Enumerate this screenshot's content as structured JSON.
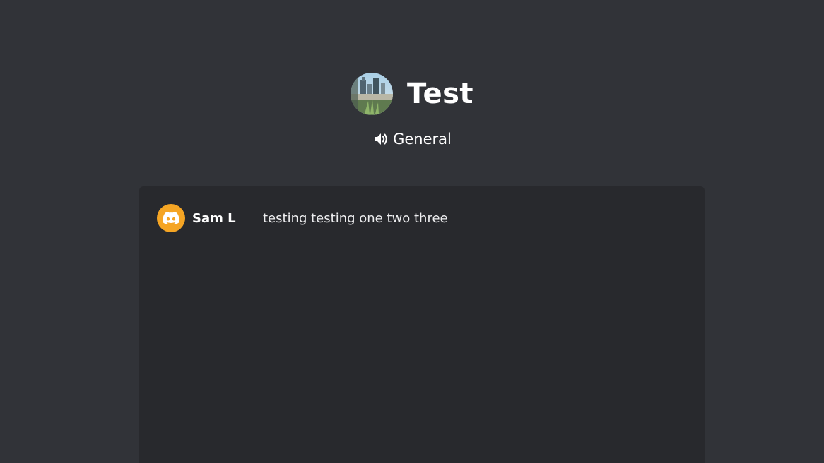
{
  "server": {
    "name": "Test",
    "avatar_icon": "server-photo-avatar"
  },
  "channel": {
    "icon": "speaker-icon",
    "name": "General"
  },
  "messages": [
    {
      "username": "Sam L",
      "avatar_icon": "discord-logo-icon",
      "avatar_color": "#f5a524",
      "text": "testing testing one two three"
    }
  ],
  "colors": {
    "background": "#313338",
    "panel": "#28292d",
    "text": "#ffffff"
  }
}
